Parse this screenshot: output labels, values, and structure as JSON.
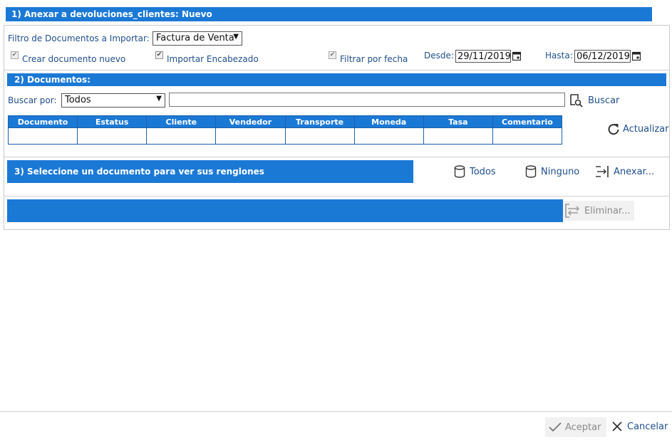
{
  "section1": {
    "title": "1) Anexar a devoluciones_clientes: Nuevo"
  },
  "filter": {
    "label": "Filtro de Documentos a Importar:",
    "selected": "Factura de Venta"
  },
  "options": {
    "create_new": "Crear documento nuevo",
    "import_header": "Importar Encabezado",
    "filter_by_date": "Filtrar por fecha"
  },
  "dates": {
    "from_label": "Desde:",
    "from_value": "29/11/2019",
    "to_label": "Hasta:",
    "to_value": "06/12/2019"
  },
  "section2": {
    "title": "2) Documentos:"
  },
  "search": {
    "label": "Buscar por:",
    "selected": "Todos",
    "value": "",
    "button": "Buscar"
  },
  "table": {
    "columns": [
      "Documento",
      "Estatus",
      "Cliente",
      "Vendedor",
      "Transporte",
      "Moneda",
      "Tasa",
      "Comentario"
    ]
  },
  "refresh": {
    "label": "Actualizar"
  },
  "section3": {
    "title": "3) Seleccione un documento para ver sus renglones"
  },
  "actions": {
    "all": "Todos",
    "none": "Ninguno",
    "attach": "Anexar...",
    "delete": "Eliminar..."
  },
  "footer": {
    "accept": "Aceptar",
    "cancel": "Cancelar"
  }
}
